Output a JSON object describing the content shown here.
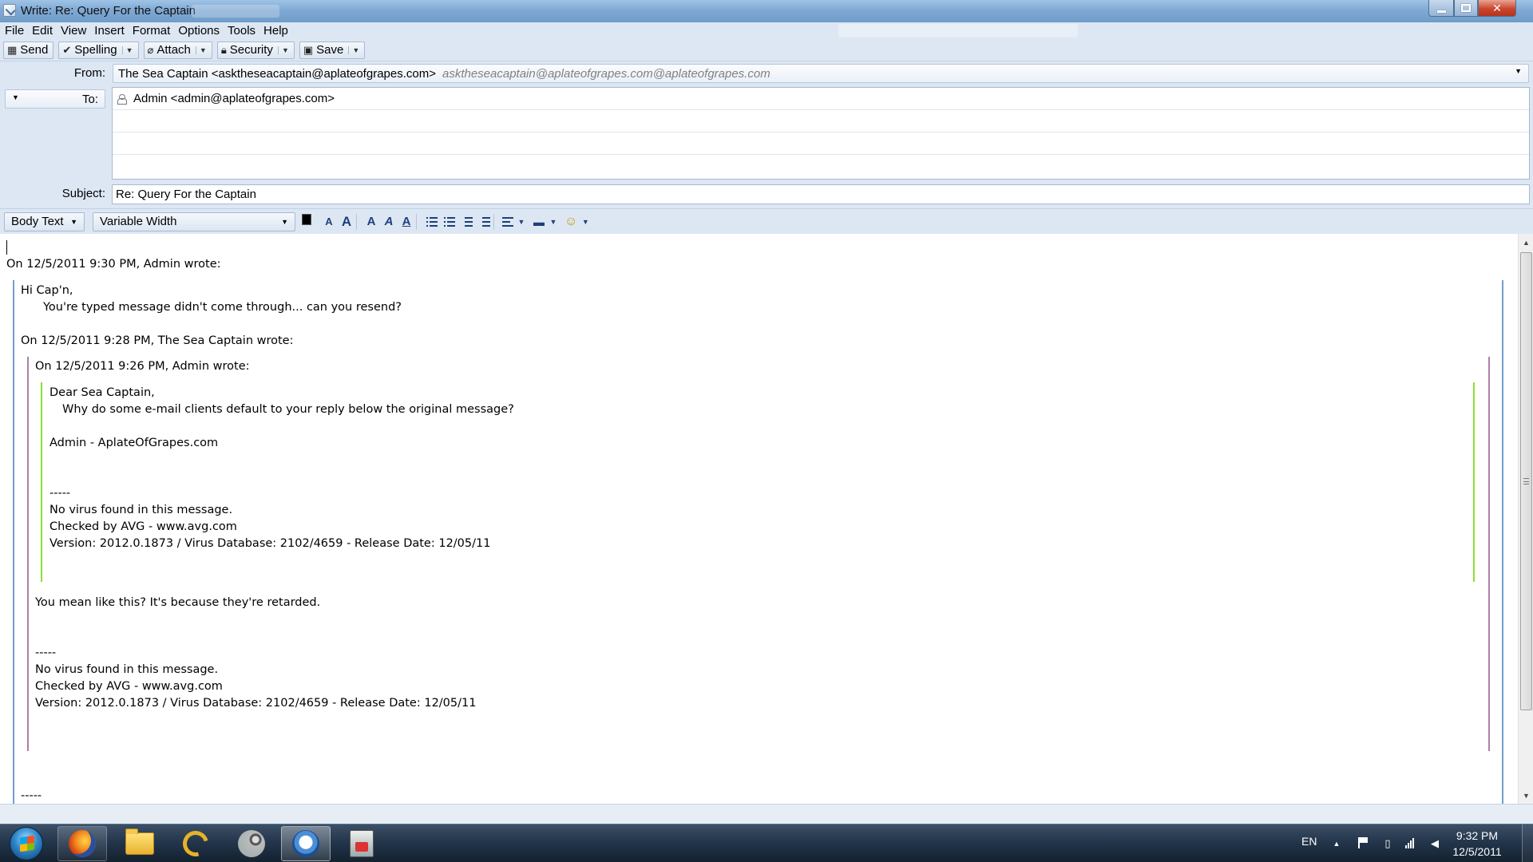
{
  "window": {
    "title": "Write: Re: Query For the Captain"
  },
  "menu": [
    "File",
    "Edit",
    "View",
    "Insert",
    "Format",
    "Options",
    "Tools",
    "Help"
  ],
  "toolbar": {
    "send": "Send",
    "spelling": "Spelling",
    "attach": "Attach",
    "security": "Security",
    "save": "Save"
  },
  "header": {
    "from_label": "From:",
    "from_identity": "The Sea Captain <asktheseacaptain@aplateofgrapes.com>",
    "from_alias": "asktheseacaptain@aplateofgrapes.com@aplateofgrapes.com",
    "to_label": "To:",
    "recipients": [
      "Admin <admin@aplateofgrapes.com>",
      "",
      "",
      ""
    ],
    "subject_label": "Subject:",
    "subject_value": "Re: Query For the Captain"
  },
  "format_toolbar": {
    "paragraph_style": "Body Text",
    "font": "Variable Width",
    "text_color": "#000000",
    "smaller_font": "A",
    "larger_font": "A",
    "bold": "A",
    "italic": "A",
    "underline": "A"
  },
  "body": {
    "attribution_1": "On 12/5/2011 9:30 PM, Admin wrote:",
    "greeting": "Hi Cap'n,",
    "admin_reply": "You're typed message didn't come through... can you resend?",
    "attribution_2": "On 12/5/2011 9:28 PM, The Sea Captain wrote:",
    "attribution_3": "On 12/5/2011 9:26 PM, Admin wrote:",
    "original_greeting": "Dear Sea Captain,",
    "original_question": "Why do some e-mail clients default to your reply below the original message?",
    "original_signature": "Admin - AplateOfGrapes.com",
    "sig_sep_1": "-----",
    "avg_1_line_1": "No virus found in this message.",
    "avg_1_line_2": "Checked by AVG - www.avg.com",
    "avg_1_line_3": "Version: 2012.0.1873 / Virus Database: 2102/4659 - Release Date: 12/05/11",
    "captain_reply": "You mean like this? It's because they're retarded.",
    "sig_sep_2": "-----",
    "avg_2_line_1": "No virus found in this message.",
    "avg_2_line_2": "Checked by AVG - www.avg.com",
    "avg_2_line_3": "Version: 2012.0.1873 / Virus Database: 2102/4659 - Release Date: 12/05/11",
    "sig_sep_3": "-----"
  },
  "quote_colors": {
    "level_1": "#729fcf",
    "level_2": "#ad7fa8",
    "level_3": "#8ae234"
  },
  "taskbar": {
    "apps": [
      "firefox-icon",
      "folder-icon",
      "daemon-tools-icon",
      "steam-icon",
      "thunderbird-icon",
      "installer-icon"
    ],
    "language": "EN",
    "time": "9:32 PM",
    "date": "12/5/2011"
  }
}
